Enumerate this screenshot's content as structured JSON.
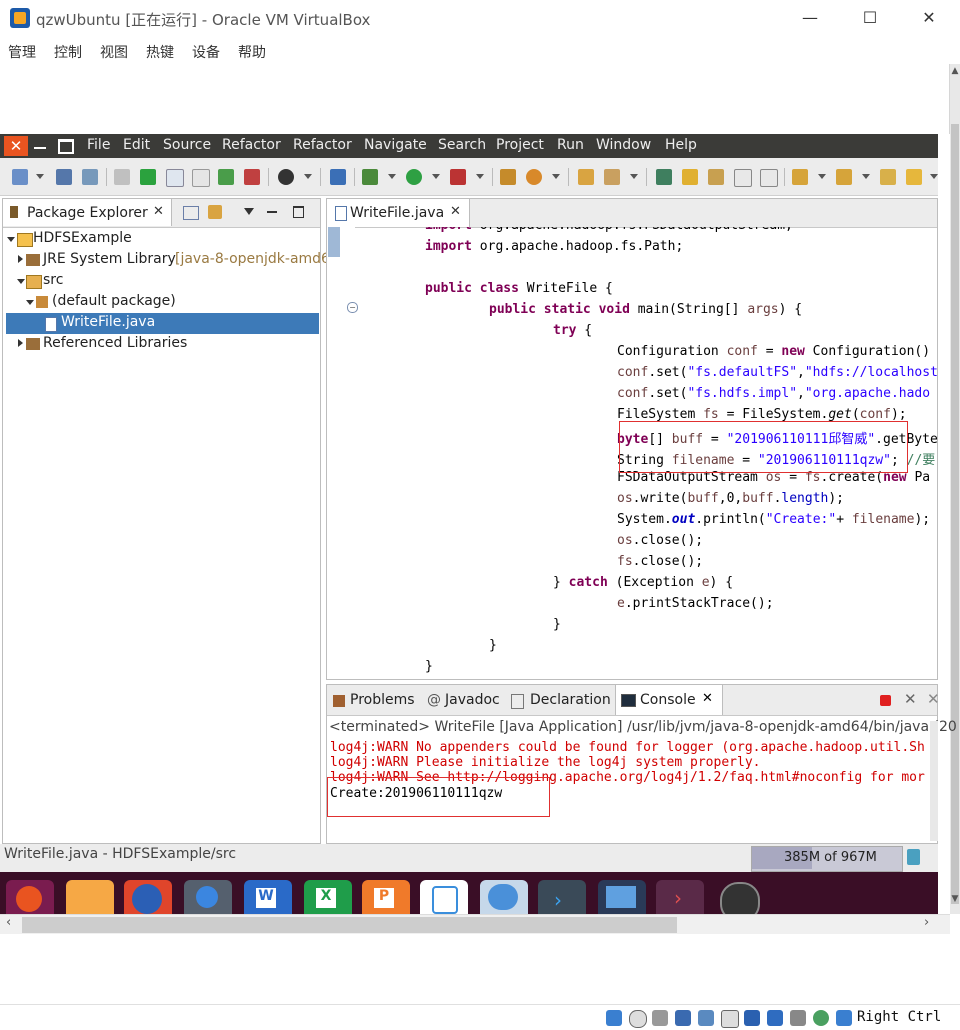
{
  "vbox": {
    "title": "qzwUbuntu [正在运行] - Oracle VM VirtualBox",
    "menu": [
      "管理",
      "控制",
      "视图",
      "热键",
      "设备",
      "帮助"
    ],
    "host_key": "Right Ctrl"
  },
  "eclipse": {
    "menu": [
      "File",
      "Edit",
      "Source",
      "Refactor",
      "Refactor",
      "Navigate",
      "Search",
      "Project",
      "Run",
      "Window",
      "Help"
    ],
    "package_explorer": {
      "tab_label": "Package Explorer",
      "tree": [
        {
          "label": "HDFSExample",
          "level": 0,
          "expanded": true
        },
        {
          "label": "JRE System Library",
          "suffix": "[java-8-openjdk-amd6",
          "level": 1,
          "expanded": false
        },
        {
          "label": "src",
          "level": 1,
          "expanded": true
        },
        {
          "label": "(default package)",
          "level": 2,
          "expanded": true
        },
        {
          "label": "WriteFile.java",
          "level": 3,
          "selected": true
        },
        {
          "label": "Referenced Libraries",
          "level": 1,
          "expanded": false
        }
      ]
    },
    "editor": {
      "tab_label": "WriteFile.java",
      "lines": [
        "import org.apache.hadoop.fs.FSDataOutputStream;",
        "import org.apache.hadoop.fs.Path;",
        "",
        "public class WriteFile {",
        "public static void main(String[] args) {",
        "try {",
        "Configuration conf = new Configuration()",
        "conf.set(\"fs.defaultFS\",\"hdfs://localhost",
        "conf.set(\"fs.hdfs.impl\",\"org.apache.hado",
        "FileSystem fs = FileSystem.get(conf);",
        "byte[] buff = \"201906110111邱智威\".getByte",
        "String filename = \"201906110111qzw\"; //要",
        "FSDataOutputStream os = fs.create(new Pa",
        "os.write(buff,0,buff.length);",
        "System.out.println(\"Create:\"+ filename);",
        "os.close();",
        "fs.close();",
        "} catch (Exception e) {",
        "e.printStackTrace();",
        "}",
        "}",
        "}"
      ]
    },
    "console": {
      "tabs": [
        "Problems",
        "Javadoc",
        "Declaration",
        "Console"
      ],
      "active_tab": "Console",
      "header": "<terminated> WriteFile [Java Application] /usr/lib/jvm/java-8-openjdk-amd64/bin/java (20",
      "warnings": [
        "log4j:WARN No appenders could be found for logger (org.apache.hadoop.util.Sh",
        "log4j:WARN Please initialize the log4j system properly.",
        "log4j:WARN See http://logging.apache.org/log4j/1.2/faq.html#noconfig for mor"
      ],
      "output": "Create:201906110111qzw"
    },
    "status": {
      "path": "WriteFile.java - HDFSExample/src",
      "memory": "385M of 967M"
    }
  },
  "colors": {
    "ubuntu_orange": "#e95420",
    "eclipse_dark": "#3b3b38",
    "keyword": "#7f0055",
    "string": "#2a00ff",
    "warn": "#d00000",
    "highlight_box": "#e03030",
    "selection": "#3d7ab8"
  }
}
